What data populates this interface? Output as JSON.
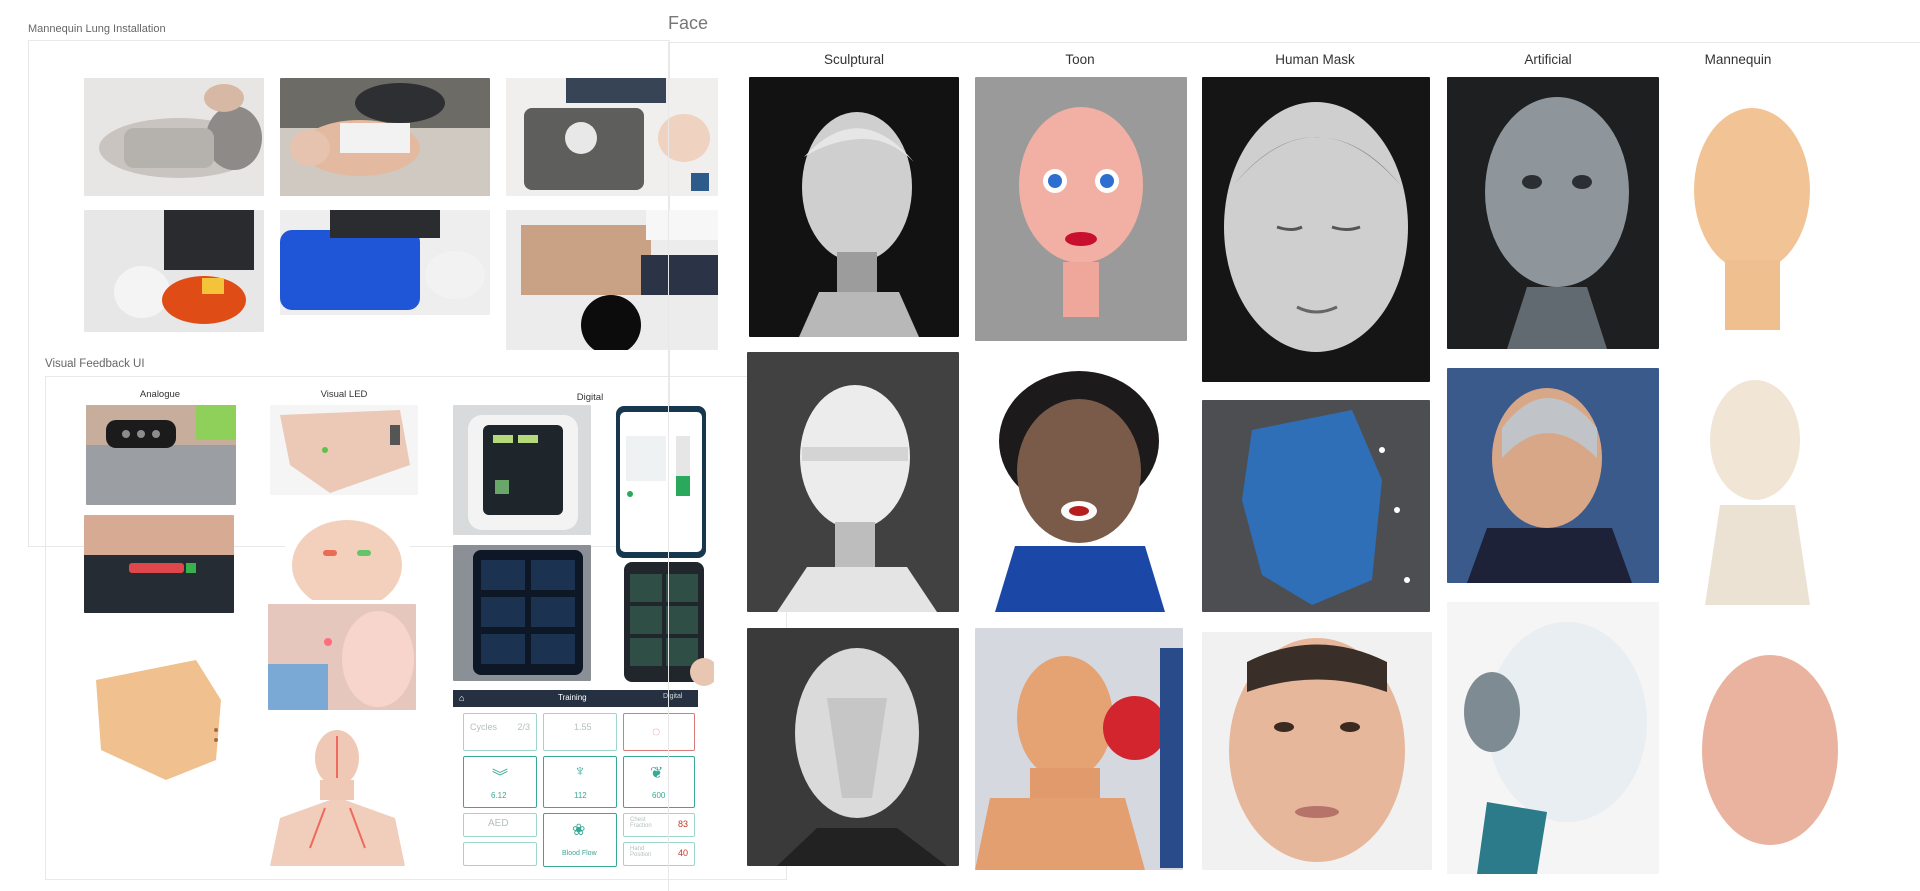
{
  "boards": {
    "lung": {
      "title": "Mannequin Lung Installation"
    },
    "feedback": {
      "title": "Visual Feedback UI",
      "sections": [
        "Analogue",
        "Visual LED",
        "Digital"
      ]
    },
    "face": {
      "title": "Face",
      "columns": [
        "Sculptural",
        "Toon",
        "Human Mask",
        "Artificial",
        "Mannequin"
      ]
    }
  },
  "digital_ui": {
    "header": "Training",
    "header_right": "Digital",
    "tiles": [
      {
        "label": "Cycles",
        "value": "2/3"
      },
      {
        "label": "",
        "value": "1.55"
      },
      {
        "label": "",
        "value": "6.12"
      },
      {
        "label": "",
        "value": "112"
      },
      {
        "label": "",
        "value": "600"
      },
      {
        "label": "AED",
        "value": ""
      },
      {
        "label": "Chest Fraction",
        "value": "83"
      },
      {
        "label": "Blood Flow",
        "value": ""
      },
      {
        "label": "Hand Position",
        "value": "40"
      }
    ]
  },
  "colors": {
    "teal": "#3aa896",
    "bg": "#ffffff",
    "text": "#333333",
    "tile_border": "#9fd6cc"
  }
}
